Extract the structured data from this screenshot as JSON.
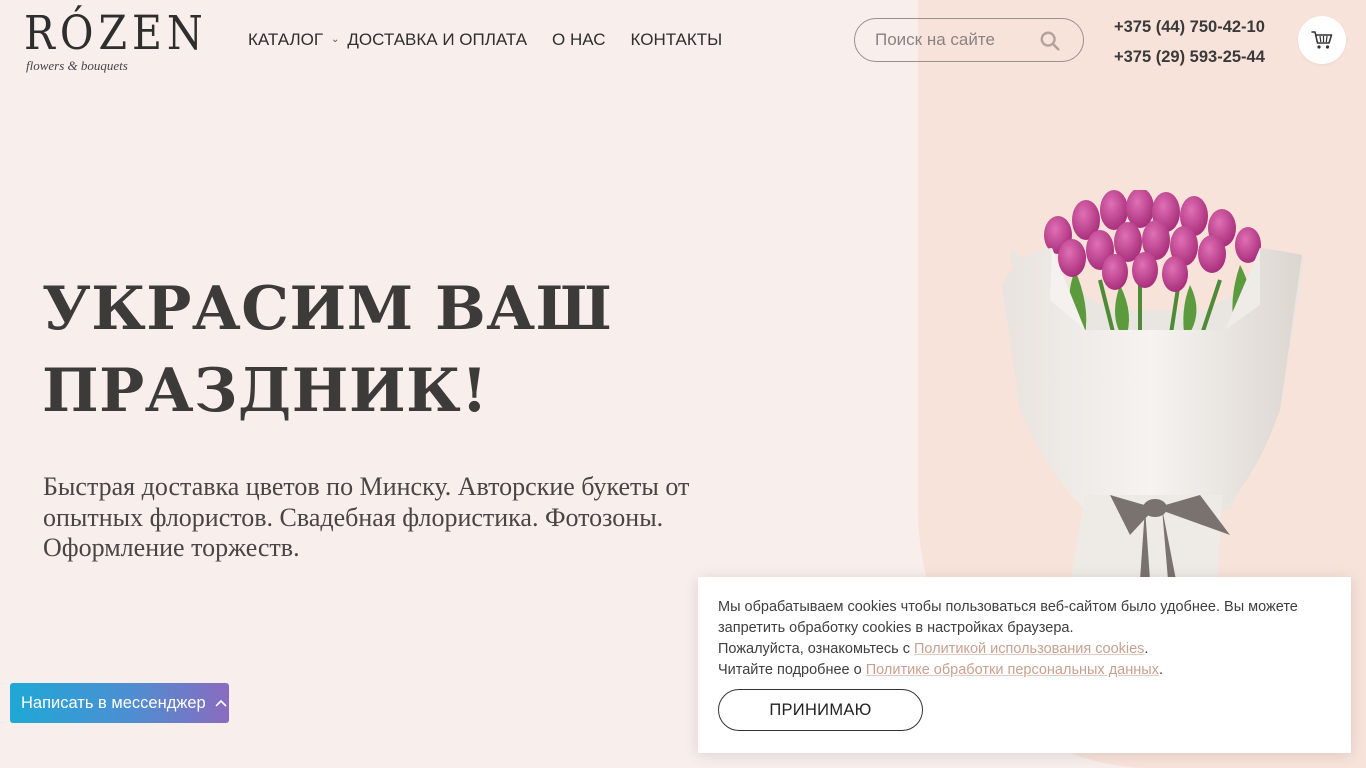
{
  "header": {
    "logo": {
      "main": "RÓZEN",
      "sub": "flowers & bouquets"
    },
    "nav": [
      {
        "label": "КАТАЛОГ",
        "has_dropdown": true
      },
      {
        "label": "ДОСТАВКА И ОПЛАТА"
      },
      {
        "label": "О НАС"
      },
      {
        "label": "КОНТАКТЫ"
      }
    ],
    "search": {
      "placeholder": "Поиск на сайте",
      "icon": "search-icon"
    },
    "phones": [
      "+375 (44) 750-42-10",
      "+375 (29) 593-25-44"
    ],
    "cart": {
      "icon": "cart-icon"
    }
  },
  "hero": {
    "title_line1": "УКРАСИМ ВАШ",
    "title_line2": "ПРАЗДНИК!",
    "subtitle": "Быстрая доставка цветов по Минску. Авторские букеты от опытных флористов. Свадебная флористика. Фотозоны. Оформление торжеств."
  },
  "cookie": {
    "text1": "Мы обрабатываем cookies чтобы пользоваться веб-сайтом было удобнее. Вы можете запретить обработку cookies в настройках браузера.",
    "text2_prefix": "Пожалуйста, ознакомьтесь с ",
    "link1": "Политикой использования cookies",
    "text3_prefix": "Читайте подробнее о ",
    "link2": "Политике обработки персональных данных",
    "period": ".",
    "button": "ПРИНИМАЮ"
  },
  "messenger": {
    "label": "Написать в мессенджер"
  },
  "colors": {
    "background": "#f8eeec",
    "arch": "#f8e3da",
    "link": "#c8a08f",
    "tulip": "#c0398a"
  }
}
